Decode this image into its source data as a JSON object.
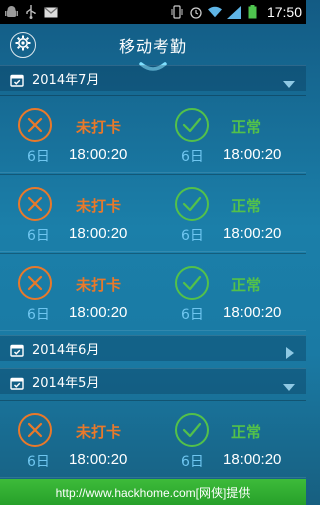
{
  "statusbar": {
    "time": "17:50",
    "left_icons": [
      "android-icon",
      "usb-icon",
      "gmail-icon"
    ],
    "right_icons": [
      "vibrate-icon",
      "alarm-icon",
      "wifi-icon",
      "signal-icon",
      "battery-icon"
    ]
  },
  "appbar": {
    "title": "移动考勤",
    "settings_icon": "gear-icon"
  },
  "months": [
    {
      "label": "2014年7月",
      "expanded": true,
      "records": [
        {
          "in_status": "未打卡",
          "in_day": "6日",
          "in_time": "18:00:20",
          "out_status": "正常",
          "out_day": "6日",
          "out_time": "18:00:20"
        },
        {
          "in_status": "未打卡",
          "in_day": "6日",
          "in_time": "18:00:20",
          "out_status": "正常",
          "out_day": "6日",
          "out_time": "18:00:20"
        },
        {
          "in_status": "未打卡",
          "in_day": "6日",
          "in_time": "18:00:20",
          "out_status": "正常",
          "out_day": "6日",
          "out_time": "18:00:20"
        }
      ]
    },
    {
      "label": "2014年6月",
      "expanded": false,
      "records": []
    },
    {
      "label": "2014年5月",
      "expanded": true,
      "records": [
        {
          "in_status": "未打卡",
          "in_day": "6日",
          "in_time": "18:00:20",
          "out_status": "正常",
          "out_day": "6日",
          "out_time": "18:00:20"
        }
      ]
    }
  ],
  "footer": {
    "watermark": "http://www.hackhome.com[网侠]提供"
  },
  "colors": {
    "missed": "#e9792a",
    "normal": "#53c14a",
    "day": "#6fc6f0"
  }
}
